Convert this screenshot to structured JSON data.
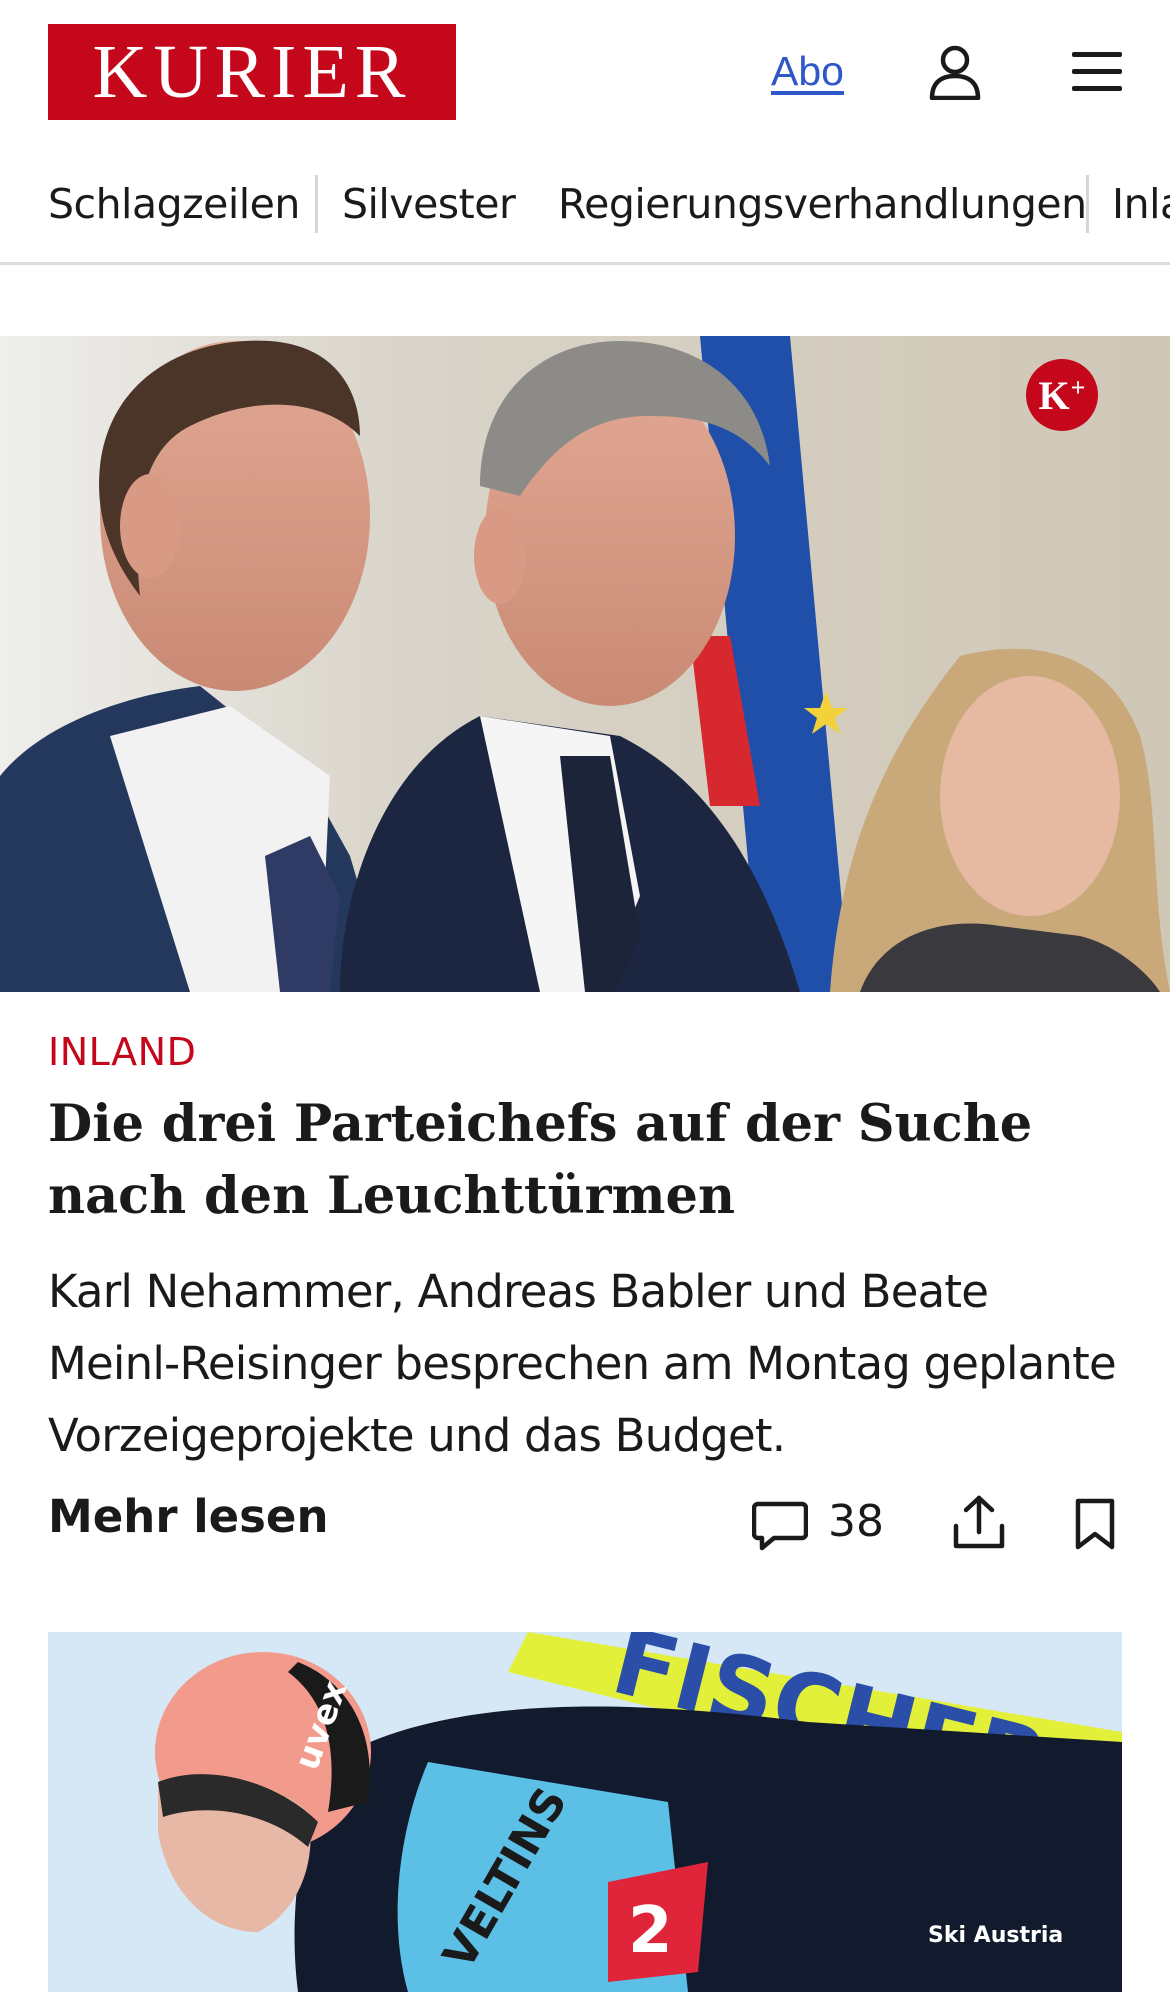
{
  "header": {
    "logo": "KURIER",
    "abo_label": "Abo",
    "icons": [
      "user-icon",
      "menu-icon"
    ]
  },
  "nav": {
    "items": [
      "Schlagzeilen",
      "Silvester",
      "Regierungsverhandlungen",
      "Inland"
    ]
  },
  "hero": {
    "badge": "K",
    "badge_sup": "+"
  },
  "article": {
    "category": "INLAND",
    "headline": "Die drei Parteichefs auf der Suche nach den Leuchttürmen",
    "teaser": "Karl Nehammer, Andreas Babler und Beate Meinl-Reisinger besprechen am Montag geplante Vorzeigeprojekte und das Budget.",
    "more_label": "Mehr lesen",
    "comment_count": "38"
  },
  "second_article": {
    "image_text_1": "FISCHER",
    "image_text_2": "uvex",
    "image_text_3": "VELTINS",
    "image_text_4": "Ski Austria"
  },
  "colors": {
    "brand_red": "#c4071b",
    "link_blue": "#2f58c7"
  }
}
